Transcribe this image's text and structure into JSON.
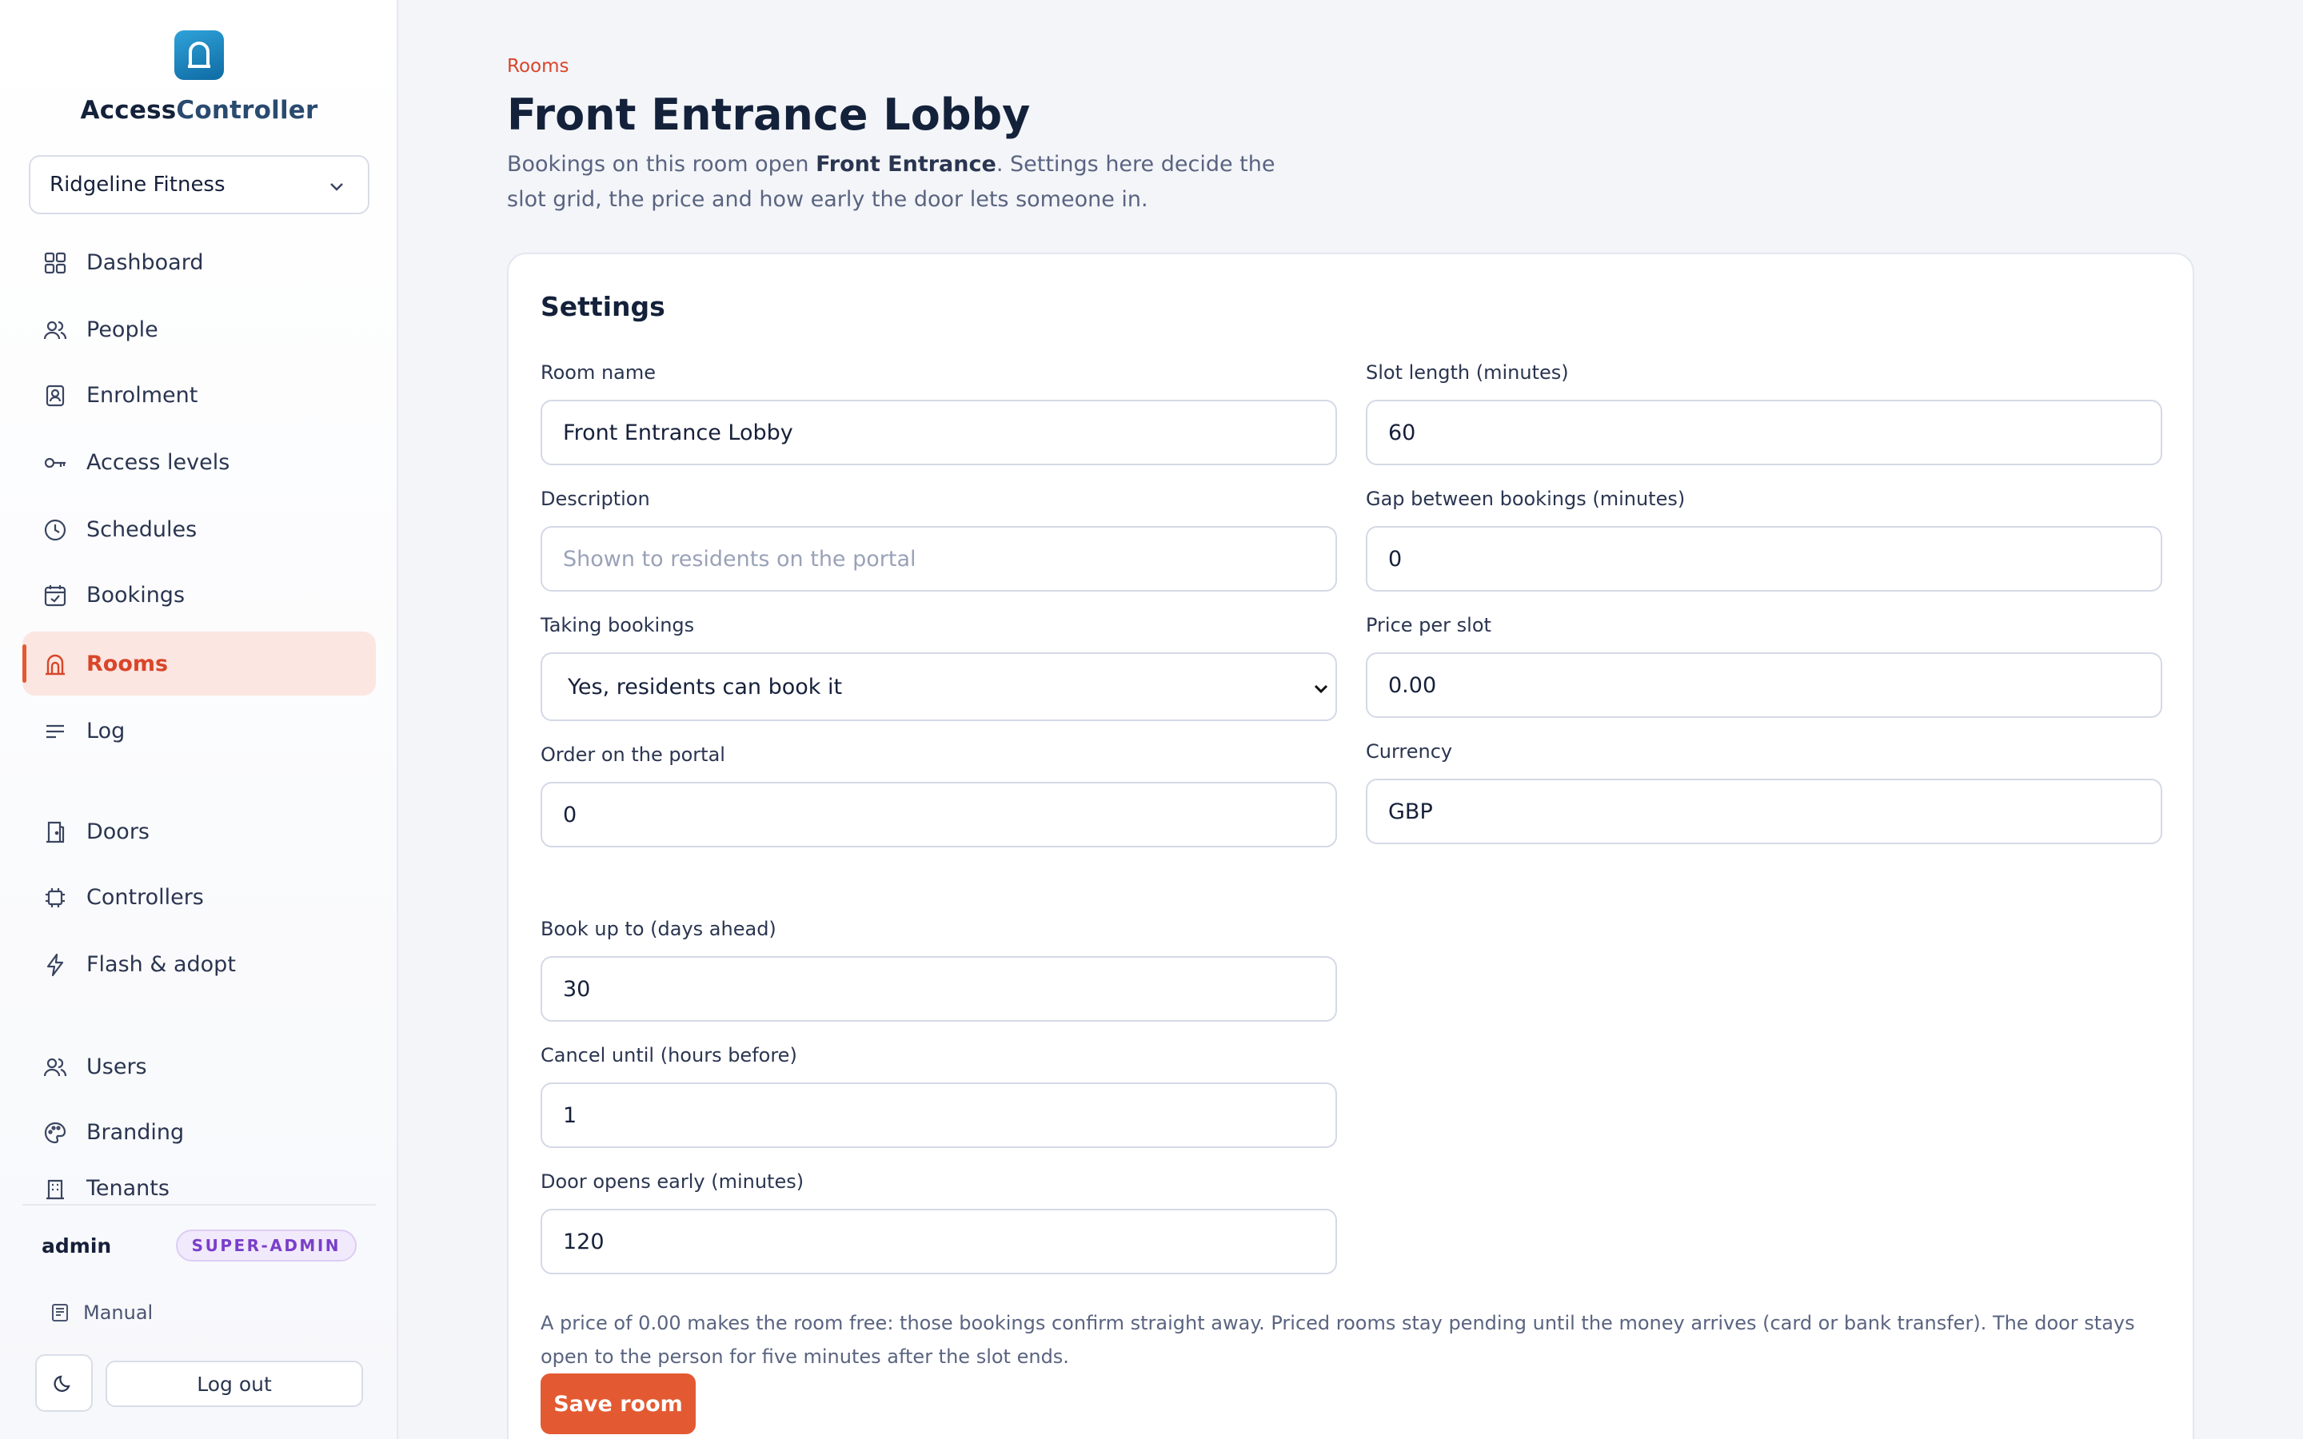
{
  "brand": {
    "name_part1": "Access",
    "name_part2": "Controller"
  },
  "tenant": {
    "selected": "Ridgeline Fitness"
  },
  "nav": {
    "items": [
      {
        "label": "Dashboard",
        "icon": "grid-icon"
      },
      {
        "label": "People",
        "icon": "people-icon"
      },
      {
        "label": "Enrolment",
        "icon": "badge-icon"
      },
      {
        "label": "Access levels",
        "icon": "key-icon"
      },
      {
        "label": "Schedules",
        "icon": "clock-icon"
      },
      {
        "label": "Bookings",
        "icon": "calendar-check-icon"
      },
      {
        "label": "Rooms",
        "icon": "door-arch-icon",
        "active": true
      },
      {
        "label": "Log",
        "icon": "lines-icon"
      },
      {
        "label": "Doors",
        "icon": "door-icon"
      },
      {
        "label": "Controllers",
        "icon": "chip-icon"
      },
      {
        "label": "Flash & adopt",
        "icon": "bolt-icon"
      },
      {
        "label": "Users",
        "icon": "users-icon"
      },
      {
        "label": "Branding",
        "icon": "palette-icon"
      },
      {
        "label": "Tenants",
        "icon": "building-icon"
      }
    ]
  },
  "user": {
    "name": "admin",
    "role": "SUPER-ADMIN"
  },
  "footer": {
    "manual": "Manual",
    "logout": "Log out"
  },
  "page": {
    "breadcrumb": "Rooms",
    "title": "Front Entrance Lobby",
    "desc_before": "Bookings on this room open ",
    "desc_strong": "Front Entrance",
    "desc_after": ". Settings here decide the slot grid, the price and how early the door lets someone in."
  },
  "settings": {
    "title": "Settings",
    "room_name": {
      "label": "Room name",
      "value": "Front Entrance Lobby"
    },
    "description": {
      "label": "Description",
      "placeholder": "Shown to residents on the portal"
    },
    "taking_bookings": {
      "label": "Taking bookings",
      "value": "Yes, residents can book it"
    },
    "order": {
      "label": "Order on the portal",
      "value": "0"
    },
    "slot_length": {
      "label": "Slot length (minutes)",
      "value": "60"
    },
    "gap": {
      "label": "Gap between bookings (minutes)",
      "value": "0"
    },
    "price": {
      "label": "Price per slot",
      "value": "0.00"
    },
    "currency": {
      "label": "Currency",
      "value": "GBP"
    },
    "book_ahead": {
      "label": "Book up to (days ahead)",
      "value": "30"
    },
    "cancel_until": {
      "label": "Cancel until (hours before)",
      "value": "1"
    },
    "door_early": {
      "label": "Door opens early (minutes)",
      "value": "120"
    },
    "help": "A price of 0.00 makes the room free: those bookings confirm straight away. Priced rooms stay pending until the money arrives (card or bank transfer). The door stays open to the person for five minutes after the slot ends.",
    "save": "Save room"
  },
  "colors": {
    "accent": "#e35a32",
    "active_bg": "#fbe6e1",
    "badge": "#7a3fc9"
  }
}
